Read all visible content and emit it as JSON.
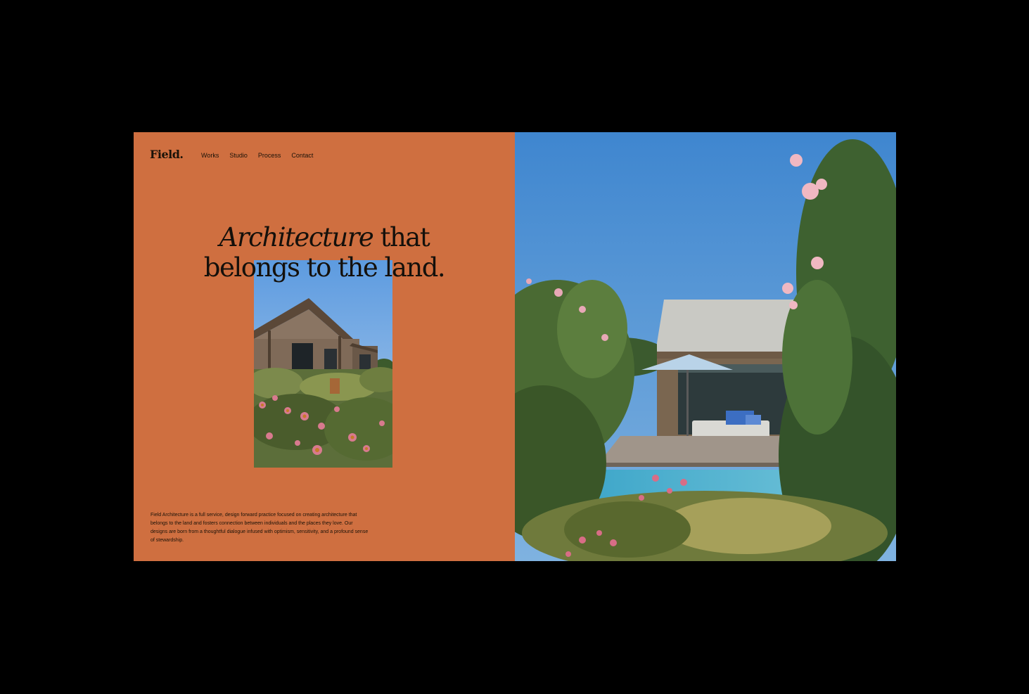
{
  "brand": {
    "logo_text": "Field."
  },
  "nav": {
    "items": [
      {
        "label": "Works"
      },
      {
        "label": "Studio"
      },
      {
        "label": "Process"
      },
      {
        "label": "Contact"
      }
    ]
  },
  "hero": {
    "headline_italic": "Architecture",
    "headline_rest_line1": " that",
    "headline_line2": "belongs to the land.",
    "description": "Field Architecture is a full service, design forward practice focused on creating architecture that belongs to the land and fosters connection between individuals and the places they love. Our designs are born from a thoughtful dialogue infused with optimism, sensitivity, and a profound sense of stewardship."
  },
  "colors": {
    "background": "#000000",
    "panel_accent": "#cf6f40",
    "text_dark": "#1a1208",
    "sky_blue": "#4a8fd0"
  },
  "images": {
    "inset": "house-with-wildflowers-photo",
    "feature": "pool-house-garden-photo"
  }
}
